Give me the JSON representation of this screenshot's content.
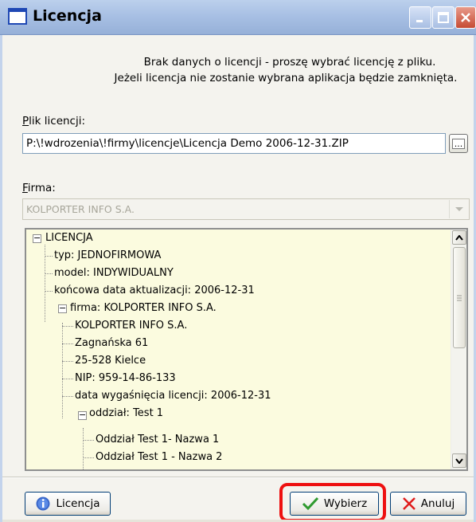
{
  "window": {
    "title": "Licencja",
    "controls": {
      "minimize": "minimize-icon",
      "maximize": "maximize-icon",
      "close": "close-icon"
    }
  },
  "info": {
    "line1": "Brak danych o licencji - proszę wybrać licencję z pliku.",
    "line2": "Jeżeli licencja nie zostanie wybrana aplikacja będzie zamknięta."
  },
  "plik": {
    "label_first": "P",
    "label_rest": "lik licencji:",
    "value": "P:\\!wdrozenia\\!firmy\\licencje\\Licencja Demo 2006-12-31.ZIP",
    "browse_label": "..."
  },
  "firma": {
    "label_first": "F",
    "label_rest": "irma:",
    "value": "KOLPORTER INFO S.A."
  },
  "tree": {
    "items": [
      "LICENCJA",
      "typ:  JEDNOFIRMOWA",
      "model:  INDYWIDUALNY",
      "końcowa data aktualizacji:  2006-12-31",
      "firma:  KOLPORTER INFO S.A.",
      "KOLPORTER INFO S.A.",
      "Zagnańska 61",
      "25-528 Kielce",
      "NIP:  959-14-86-133",
      "data wygaśnięcia licencji:  2006-12-31",
      "oddział:  Test 1",
      "Oddział Test 1- Nazwa 1",
      "Oddział Test 1 - Nazwa 2"
    ]
  },
  "buttons": {
    "licencja": "Licencja",
    "wybierz": "Wybierz",
    "anuluj": "Anuluj"
  },
  "colors": {
    "titlebar": "#a8c0e4",
    "tree_background": "#fbfbdf",
    "highlight": "#ee1010",
    "ok_check": "#2f9a2f",
    "cancel_x": "#e01c1c"
  }
}
